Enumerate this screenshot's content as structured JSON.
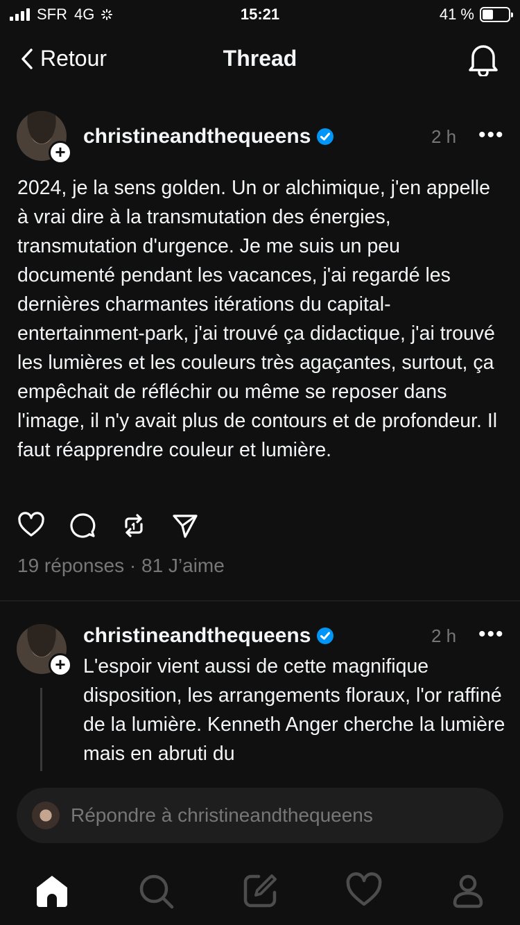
{
  "status_bar": {
    "carrier": "SFR",
    "network": "4G",
    "time": "15:21",
    "battery": "41 %",
    "battery_level": 0.41
  },
  "nav": {
    "back_label": "Retour",
    "title": "Thread",
    "bell_icon": "bell-icon"
  },
  "post": {
    "username": "christineandthequeens",
    "time": "2 h",
    "text": "2024, je la sens golden. Un or alchimique, j'en appelle à vrai dire à la transmutation des énergies, transmutation d'urgence. Je me suis un peu documenté pendant les vacances, j'ai regardé les dernières charmantes itérations du capital-entertainment-park, j'ai trouvé ça didactique, j'ai trouvé les lumières et les couleurs très agaçantes, surtout, ça empêchait de réfléchir ou même se reposer dans l'image, il n'y avait plus de contours et de profondeur. Il faut réapprendre couleur et lumière.",
    "stats": "19 réponses · 81 J’aime"
  },
  "reply": {
    "username": "christineandthequeens",
    "time": "2 h",
    "text": "L'espoir vient aussi de cette magnifique disposition, les arrangements floraux, l'or raffiné de la lumière. Kenneth Anger cherche la lumière mais en abruti du"
  },
  "composer": {
    "placeholder": "Répondre à christineandthequeens"
  },
  "colors": {
    "background": "#101010",
    "verified": "#0095f6",
    "muted": "#777777"
  }
}
